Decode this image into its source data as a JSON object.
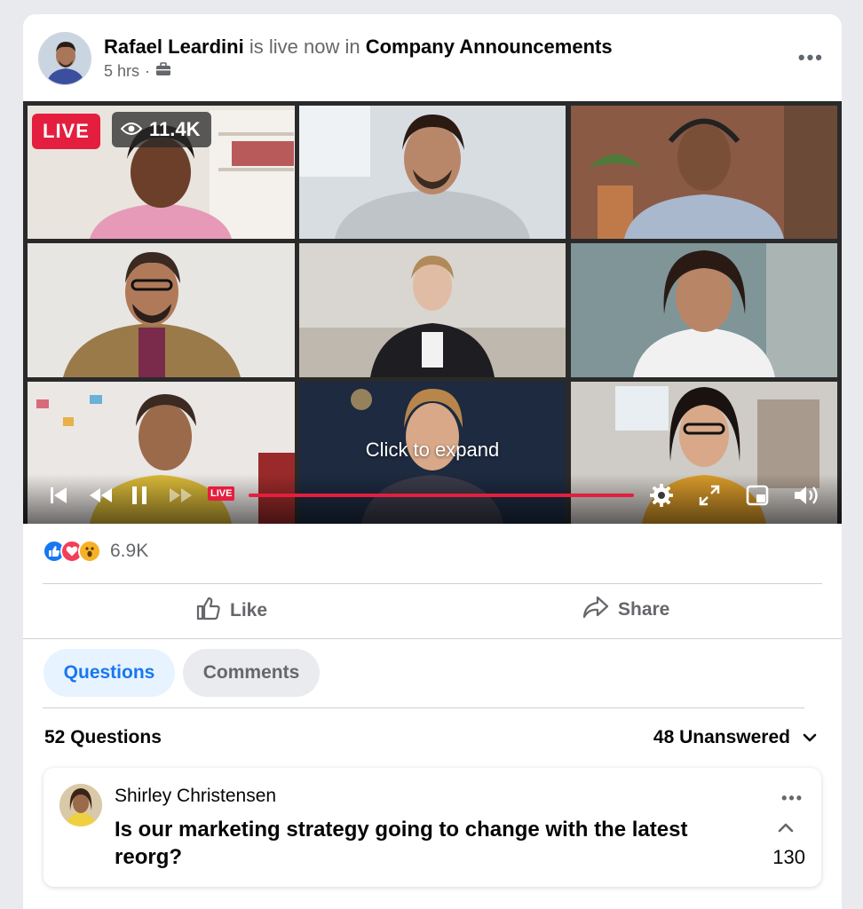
{
  "post": {
    "author": "Rafael Leardini",
    "status_text": "is live now in",
    "group": "Company Announcements",
    "time": "5 hrs",
    "separator": "·",
    "audience_icon": "briefcase-icon",
    "more_icon": "more-dots-icon"
  },
  "video": {
    "live_label": "LIVE",
    "views": "11.4K",
    "expand_hint": "Click to expand",
    "mini_live_label": "LIVE",
    "progress": 1.0,
    "controls": [
      "skip-back-icon",
      "rewind-icon",
      "pause-icon",
      "fast-forward-icon",
      "settings-icon",
      "fullscreen-icon",
      "pip-icon",
      "volume-icon"
    ]
  },
  "reactions": {
    "count": "6.9K",
    "types": [
      "like",
      "love",
      "wow"
    ]
  },
  "actions": {
    "like_label": "Like",
    "share_label": "Share"
  },
  "tabs": {
    "questions_label": "Questions",
    "comments_label": "Comments",
    "active": "Questions"
  },
  "questions": {
    "total_label": "52 Questions",
    "filter_label": "48 Unanswered",
    "items": [
      {
        "author": "Shirley Christensen",
        "text": "Is our marketing strategy going to change with the latest reorg?",
        "votes": "130"
      }
    ]
  },
  "colors": {
    "brand_blue": "#1877f2",
    "live_red": "#e41e3f",
    "muted": "#65676b"
  }
}
